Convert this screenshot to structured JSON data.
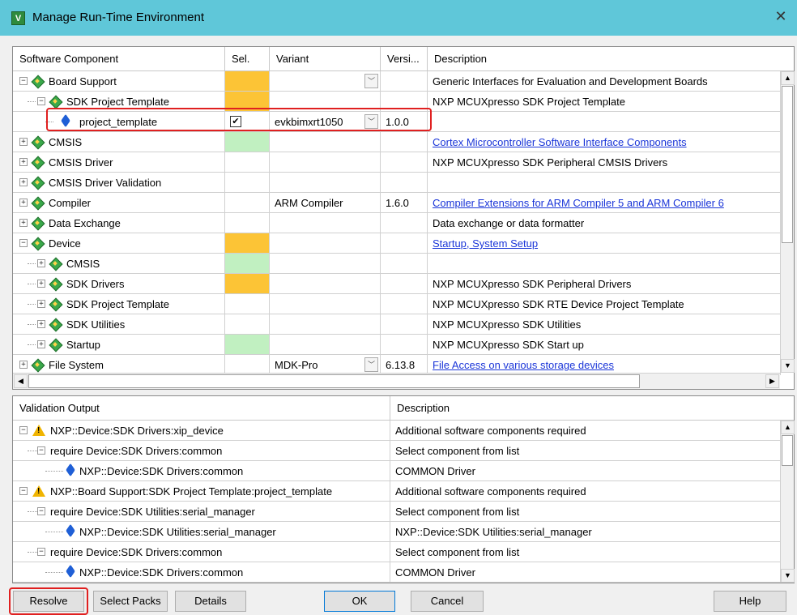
{
  "window": {
    "title": "Manage Run-Time Environment",
    "close_glyph": "✕",
    "app_icon_glyph": "V"
  },
  "components": {
    "headers": {
      "name": "Software Component",
      "sel": "Sel.",
      "variant": "Variant",
      "version": "Versi...",
      "description": "Description"
    },
    "rows": [
      {
        "name": "Board Support",
        "depth": 0,
        "icon": "gem-icon",
        "expander": "minus",
        "sel": "orange",
        "variant": "",
        "variant_dropdown": true,
        "version": "",
        "description": "Generic Interfaces for Evaluation and Development Boards",
        "link": false
      },
      {
        "name": "SDK Project Template",
        "depth": 1,
        "icon": "gem-icon",
        "expander": "minus",
        "sel": "orange",
        "variant": "",
        "variant_dropdown": false,
        "version": "",
        "description": "NXP MCUXpresso SDK Project Template",
        "link": false
      },
      {
        "name": "project_template",
        "depth": 2,
        "icon": "component-icon",
        "expander": "",
        "sel": "checked",
        "variant": "evkbimxrt1050",
        "variant_dropdown": true,
        "version": "1.0.0",
        "description": "",
        "link": false
      },
      {
        "name": "CMSIS",
        "depth": 0,
        "icon": "gem-icon",
        "expander": "plus",
        "sel": "green",
        "variant": "",
        "variant_dropdown": false,
        "version": "",
        "description": "Cortex Microcontroller Software Interface Components",
        "link": true
      },
      {
        "name": "CMSIS Driver",
        "depth": 0,
        "icon": "gem-icon",
        "expander": "plus",
        "sel": "",
        "variant": "",
        "variant_dropdown": false,
        "version": "",
        "description": "NXP MCUXpresso SDK Peripheral CMSIS Drivers",
        "link": false
      },
      {
        "name": "CMSIS Driver Validation",
        "depth": 0,
        "icon": "gem-icon",
        "expander": "plus",
        "sel": "",
        "variant": "",
        "variant_dropdown": false,
        "version": "",
        "description": "",
        "link": false
      },
      {
        "name": "Compiler",
        "depth": 0,
        "icon": "gem-icon",
        "expander": "plus",
        "sel": "",
        "variant": "ARM Compiler",
        "variant_dropdown": false,
        "version": "1.6.0",
        "description": "Compiler Extensions for ARM Compiler 5 and ARM Compiler 6",
        "link": true
      },
      {
        "name": "Data Exchange",
        "depth": 0,
        "icon": "gem-icon",
        "expander": "plus",
        "sel": "",
        "variant": "",
        "variant_dropdown": false,
        "version": "",
        "description": "Data exchange or data formatter",
        "link": false
      },
      {
        "name": "Device",
        "depth": 0,
        "icon": "gem-icon",
        "expander": "minus",
        "sel": "orange",
        "variant": "",
        "variant_dropdown": false,
        "version": "",
        "description": "Startup, System Setup",
        "link": true
      },
      {
        "name": "CMSIS",
        "depth": 1,
        "icon": "gem-icon",
        "expander": "plus",
        "sel": "green",
        "variant": "",
        "variant_dropdown": false,
        "version": "",
        "description": "",
        "link": false
      },
      {
        "name": "SDK Drivers",
        "depth": 1,
        "icon": "gem-icon",
        "expander": "plus",
        "sel": "orange",
        "variant": "",
        "variant_dropdown": false,
        "version": "",
        "description": "NXP MCUXpresso SDK Peripheral Drivers",
        "link": false
      },
      {
        "name": "SDK Project Template",
        "depth": 1,
        "icon": "gem-icon",
        "expander": "plus",
        "sel": "",
        "variant": "",
        "variant_dropdown": false,
        "version": "",
        "description": "NXP MCUXpresso SDK RTE Device Project Template",
        "link": false
      },
      {
        "name": "SDK Utilities",
        "depth": 1,
        "icon": "gem-icon",
        "expander": "plus",
        "sel": "",
        "variant": "",
        "variant_dropdown": false,
        "version": "",
        "description": "NXP MCUXpresso SDK Utilities",
        "link": false
      },
      {
        "name": "Startup",
        "depth": 1,
        "icon": "gem-icon",
        "expander": "plus",
        "sel": "green",
        "variant": "",
        "variant_dropdown": false,
        "version": "",
        "description": "NXP MCUXpresso SDK Start up",
        "link": false
      },
      {
        "name": "File System",
        "depth": 0,
        "icon": "gem-icon",
        "expander": "plus",
        "sel": "",
        "variant": "MDK-Pro",
        "variant_dropdown": true,
        "version": "6.13.8",
        "description": "File Access on various storage devices",
        "link": true
      }
    ]
  },
  "validation": {
    "headers": {
      "output": "Validation Output",
      "description": "Description"
    },
    "rows": [
      {
        "text": "NXP::Device:SDK Drivers:xip_device",
        "depth": 0,
        "icon": "warning-icon",
        "expander": "minus",
        "description": "Additional software components required"
      },
      {
        "text": "require Device:SDK Drivers:common",
        "depth": 1,
        "icon": "",
        "expander": "minus",
        "description": "Select component from list"
      },
      {
        "text": "NXP::Device:SDK Drivers:common",
        "depth": 2,
        "icon": "component-icon",
        "expander": "",
        "description": "COMMON Driver"
      },
      {
        "text": "NXP::Board Support:SDK Project Template:project_template",
        "depth": 0,
        "icon": "warning-icon",
        "expander": "minus",
        "description": "Additional software components required"
      },
      {
        "text": "require Device:SDK Utilities:serial_manager",
        "depth": 1,
        "icon": "",
        "expander": "minus",
        "description": "Select component from list"
      },
      {
        "text": "NXP::Device:SDK Utilities:serial_manager",
        "depth": 2,
        "icon": "component-icon",
        "expander": "",
        "description": "NXP::Device:SDK Utilities:serial_manager"
      },
      {
        "text": "require Device:SDK Drivers:common",
        "depth": 1,
        "icon": "",
        "expander": "minus",
        "description": "Select component from list"
      },
      {
        "text": "NXP::Device:SDK Drivers:common",
        "depth": 2,
        "icon": "component-icon",
        "expander": "",
        "description": "COMMON Driver"
      }
    ]
  },
  "buttons": {
    "resolve": "Resolve",
    "select_packs": "Select Packs",
    "details": "Details",
    "ok": "OK",
    "cancel": "Cancel",
    "help": "Help"
  },
  "glyphs": {
    "up": "▲",
    "down": "▼",
    "left": "◀",
    "right": "▶",
    "dropdown": "﹀",
    "check": "✔",
    "plus": "+",
    "minus": "−"
  },
  "colors": {
    "titlebar": "#5fc7d9",
    "sel_orange": "#fcc436",
    "sel_green": "#c1f0c1",
    "link": "#1a35d8",
    "highlight": "#e02020"
  }
}
